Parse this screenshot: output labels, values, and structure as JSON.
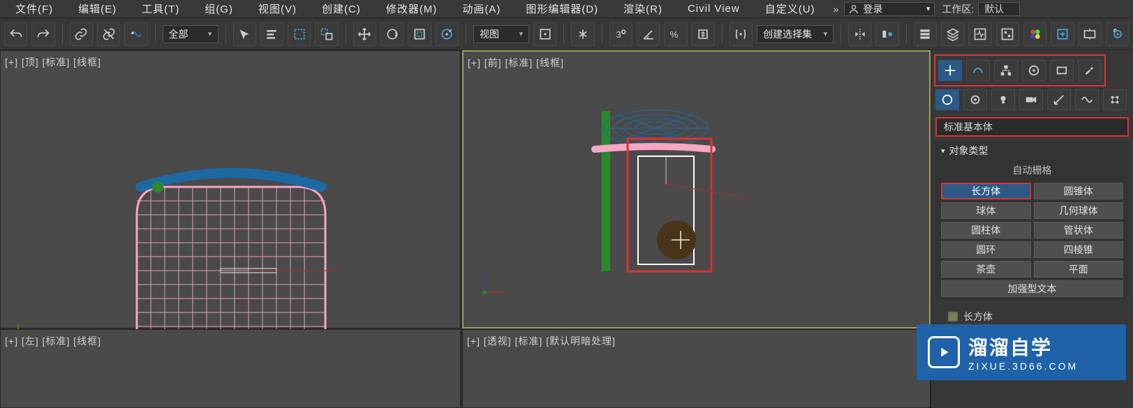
{
  "menu": {
    "items": [
      "文件(F)",
      "编辑(E)",
      "工具(T)",
      "组(G)",
      "视图(V)",
      "创建(C)",
      "修改器(M)",
      "动画(A)",
      "图形编辑器(D)",
      "渲染(R)",
      "Civil View",
      "自定义(U)"
    ],
    "login": "登录",
    "workspace_label": "工作区:",
    "workspace_value": "默认"
  },
  "toolbar": {
    "filter": "全部",
    "coord": "视图",
    "create_set": "创建选择集"
  },
  "viewports": {
    "top": "[+] [顶] [标准] [线框]",
    "front": "[+] [前] [标准] [线框]",
    "left": "[+] [左] [标准] [线框]",
    "persp": "[+] [透视] [标准] [默认明暗处理]"
  },
  "panel": {
    "category": "标准基本体",
    "rollout_object_type": "对象类型",
    "auto_grid": "自动栅格",
    "objects": [
      "长方体",
      "圆锥体",
      "球体",
      "几何球体",
      "圆柱体",
      "管状体",
      "圆环",
      "四棱锥",
      "茶壶",
      "平面",
      "加强型文本"
    ],
    "name_value": "长方体"
  },
  "watermark": {
    "big": "溜溜自学",
    "small": "ZIXUE.3D66.COM"
  },
  "chart_data": null
}
